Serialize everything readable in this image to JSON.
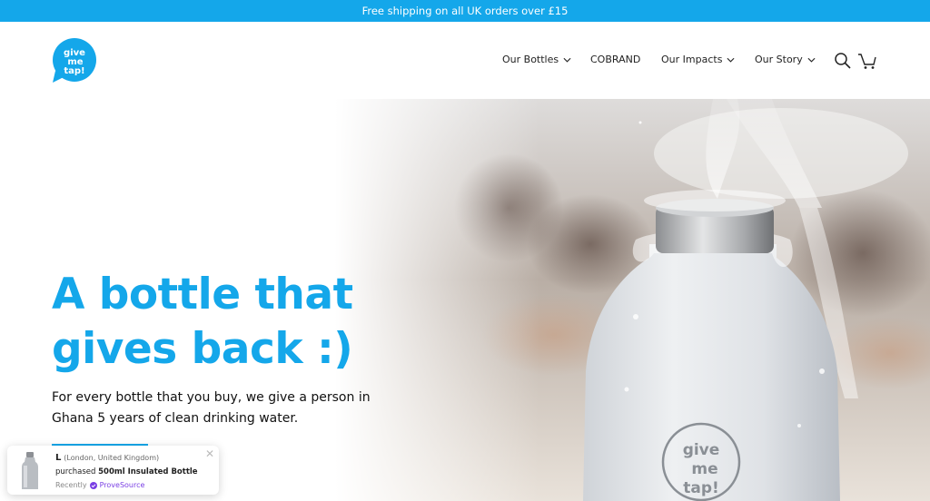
{
  "announcement": {
    "text": "Free shipping on all UK orders over £15"
  },
  "brand": {
    "logo_lines": [
      "give",
      "me",
      "tap!"
    ],
    "accent": "#14a7ea"
  },
  "nav": {
    "items": [
      {
        "label": "Our Bottles",
        "has_dropdown": true,
        "icon": "chevron-down-icon"
      },
      {
        "label": "COBRAND",
        "has_dropdown": false
      },
      {
        "label": "Our Impacts",
        "has_dropdown": true,
        "icon": "chevron-down-icon"
      },
      {
        "label": "Our Story",
        "has_dropdown": true,
        "icon": "chevron-down-icon"
      }
    ],
    "search_icon": "search-icon",
    "cart_icon": "cart-icon"
  },
  "hero": {
    "headline_line1": "A bottle that",
    "headline_line2": "gives back :)",
    "subtext": "For every bottle that you buy, we give a person in Ghana 5 years of clean drinking water.",
    "bottle_label_lines": [
      "give",
      "me",
      "tap!"
    ]
  },
  "toast": {
    "name": "L",
    "location": "(London, United Kingdom)",
    "action": "purchased",
    "product": "500ml Insulated Bottle",
    "time": "Recently",
    "provider": "ProveSource",
    "close_icon": "close-icon",
    "verified_icon": "verified-badge-icon",
    "provider_color": "#7a3fe4"
  }
}
